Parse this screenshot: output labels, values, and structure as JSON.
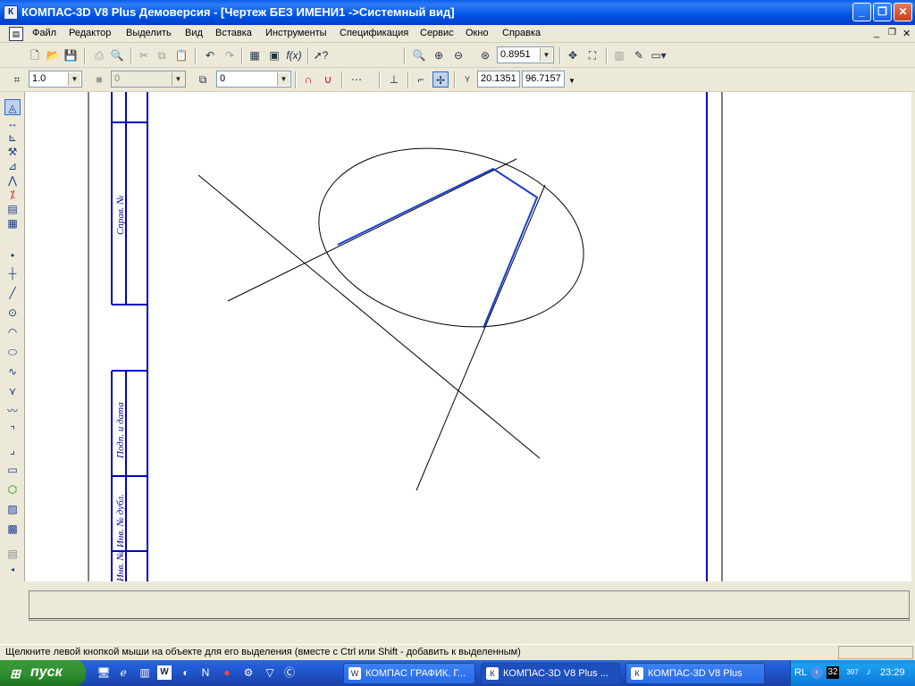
{
  "window": {
    "title": "КОМПАС-3D V8 Plus Демоверсия - [Чертеж БЕЗ ИМЕНИ1  ->Системный вид]",
    "app_icon": "kompas-logo-icon"
  },
  "menu": [
    "Файл",
    "Редактор",
    "Выделить",
    "Вид",
    "Вставка",
    "Инструменты",
    "Спецификация",
    "Сервис",
    "Окно",
    "Справка"
  ],
  "toolbar1": {
    "zoom_value": "0.8951"
  },
  "toolbar2": {
    "step_value": "1.0",
    "layer_value": "0",
    "style_value": "0",
    "coord_x": "20.1351",
    "coord_y": "96.7157"
  },
  "drawing": {
    "stamp_labels": [
      "Справ. №",
      "Подп. и дата",
      "Инв. № дубл.",
      "Инв. №"
    ],
    "colors": {
      "frame": "#0000c8",
      "line": "#000000",
      "highlight": "#1a3cd6"
    }
  },
  "statusbar": {
    "text": "Щелкните левой кнопкой мыши на объекте для его выделения (вместе с Ctrl или Shift - добавить к выделенным)"
  },
  "taskbar": {
    "start_label": "пуск",
    "tasks": [
      "КОМПАС ГРАФИК. Г...",
      "КОМПАС-3D V8 Plus ...",
      "КОМПАС-3D V8  Plus"
    ],
    "tray_lang": "RL",
    "tray_clock": "23:29",
    "tray_badge": "32",
    "tray_num": "397"
  }
}
